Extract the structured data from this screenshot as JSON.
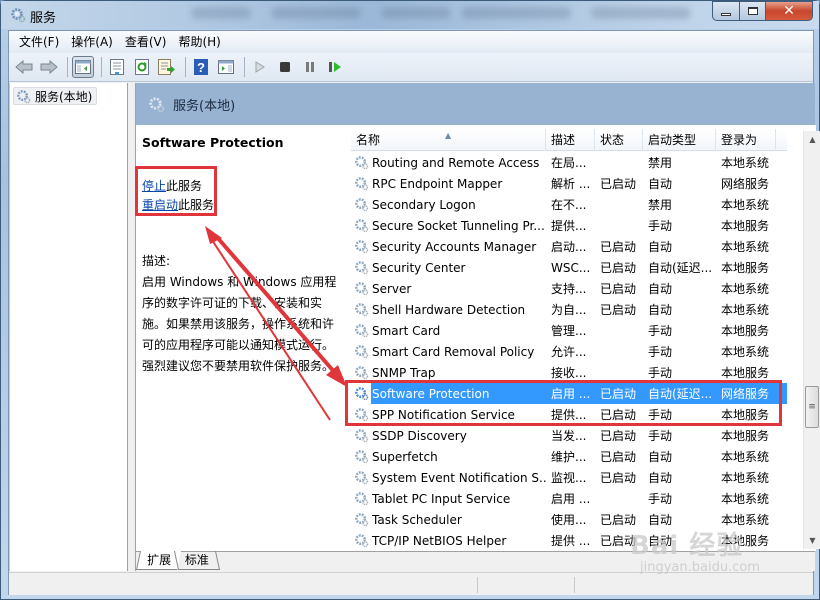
{
  "window": {
    "title": "服务",
    "minimize_label": "",
    "close_label": "✕"
  },
  "menubar": {
    "items": [
      "文件(F)",
      "操作(A)",
      "查看(V)",
      "帮助(H)"
    ]
  },
  "toolbar": {
    "buttons": [
      "back-icon",
      "forward-icon",
      "show-hide-console-tree-icon",
      "properties-icon",
      "refresh-icon",
      "export-list-icon",
      "help-icon",
      "show-hide-action-pane-icon",
      "start-service-icon",
      "stop-service-icon",
      "pause-service-icon",
      "restart-service-icon"
    ]
  },
  "tree": {
    "root_label": "服务(本地)"
  },
  "pane": {
    "header_title": "服务(本地)"
  },
  "detail": {
    "service_name": "Software Protection",
    "stop_link": "停止",
    "stop_suffix": "此服务",
    "restart_link": "重启动",
    "restart_suffix": "此服务",
    "description_label": "描述:",
    "description": "启用 Windows 和 Windows 应用程序的数字许可证的下载、安装和实施。如果禁用该服务，操作系统和许可的应用程序可能以通知模式运行。强烈建议您不要禁用软件保护服务。"
  },
  "list": {
    "columns": [
      "名称",
      "描述",
      "状态",
      "启动类型",
      "登录为"
    ],
    "sort_indicator": "▲",
    "selected_index": 11,
    "rows": [
      {
        "name": "Routing and Remote Access",
        "desc": "在局...",
        "status": "",
        "startup": "禁用",
        "logon": "本地系统"
      },
      {
        "name": "RPC Endpoint Mapper",
        "desc": "解析 ...",
        "status": "已启动",
        "startup": "自动",
        "logon": "网络服务"
      },
      {
        "name": "Secondary Logon",
        "desc": "在不...",
        "status": "",
        "startup": "禁用",
        "logon": "本地系统"
      },
      {
        "name": "Secure Socket Tunneling Pr...",
        "desc": "提供...",
        "status": "",
        "startup": "手动",
        "logon": "本地服务"
      },
      {
        "name": "Security Accounts Manager",
        "desc": "启动...",
        "status": "已启动",
        "startup": "自动",
        "logon": "本地系统"
      },
      {
        "name": "Security Center",
        "desc": "WSC...",
        "status": "已启动",
        "startup": "自动(延迟...",
        "logon": "本地服务"
      },
      {
        "name": "Server",
        "desc": "支持...",
        "status": "已启动",
        "startup": "自动",
        "logon": "本地系统"
      },
      {
        "name": "Shell Hardware Detection",
        "desc": "为自...",
        "status": "已启动",
        "startup": "自动",
        "logon": "本地系统"
      },
      {
        "name": "Smart Card",
        "desc": "管理...",
        "status": "",
        "startup": "手动",
        "logon": "本地服务"
      },
      {
        "name": "Smart Card Removal Policy",
        "desc": "允许...",
        "status": "",
        "startup": "手动",
        "logon": "本地系统"
      },
      {
        "name": "SNMP Trap",
        "desc": "接收...",
        "status": "",
        "startup": "手动",
        "logon": "本地服务"
      },
      {
        "name": "Software Protection",
        "desc": "启用 ...",
        "status": "已启动",
        "startup": "自动(延迟...",
        "logon": "网络服务"
      },
      {
        "name": "SPP Notification Service",
        "desc": "提供...",
        "status": "已启动",
        "startup": "手动",
        "logon": "本地服务"
      },
      {
        "name": "SSDP Discovery",
        "desc": "当发...",
        "status": "已启动",
        "startup": "手动",
        "logon": "本地服务"
      },
      {
        "name": "Superfetch",
        "desc": "维护...",
        "status": "已启动",
        "startup": "自动",
        "logon": "本地系统"
      },
      {
        "name": "System Event Notification S...",
        "desc": "监视...",
        "status": "已启动",
        "startup": "自动",
        "logon": "本地系统"
      },
      {
        "name": "Tablet PC Input Service",
        "desc": "启用 ...",
        "status": "",
        "startup": "手动",
        "logon": "本地系统"
      },
      {
        "name": "Task Scheduler",
        "desc": "使用...",
        "status": "已启动",
        "startup": "自动",
        "logon": "本地系统"
      },
      {
        "name": "TCP/IP NetBIOS Helper",
        "desc": "提供 ...",
        "status": "已启动",
        "startup": "自动",
        "logon": "本地服务"
      }
    ]
  },
  "tabs": [
    "扩展",
    "标准"
  ],
  "watermark": {
    "brand": "Bai 经验",
    "url": "jingyan.baidu.com"
  },
  "colors": {
    "selection": "#3399ff",
    "annotation_red": "#e0353b",
    "header_band": "#98b2d1",
    "link": "#0645ad"
  }
}
